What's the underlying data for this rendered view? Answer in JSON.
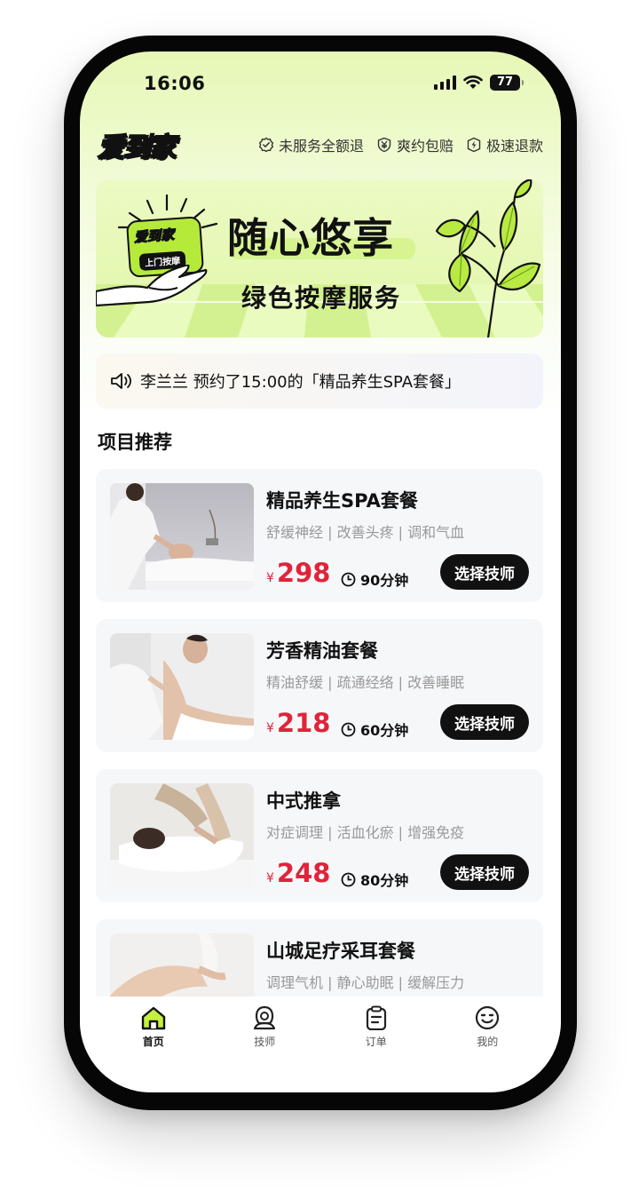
{
  "status": {
    "time": "16:06",
    "battery": "77"
  },
  "header": {
    "logo": "爱到家",
    "guarantees": [
      {
        "icon": "check-shield-icon",
        "label": "未服务全额退"
      },
      {
        "icon": "yuan-shield-icon",
        "label": "爽约包赔"
      },
      {
        "icon": "lightning-icon",
        "label": "极速退款"
      }
    ]
  },
  "banner": {
    "badge_top": "爱到家",
    "badge_bottom": "上门按摩",
    "title": "随心悠享",
    "subtitle": "绿色按摩服务"
  },
  "notice": {
    "icon": "speaker-icon",
    "text": "李兰兰 预约了15:00的「精品养生SPA套餐」"
  },
  "section": {
    "title": "项目推荐"
  },
  "services": [
    {
      "name": "精品养生SPA套餐",
      "tags": "舒缓神经 | 改善头疼 | 调和气血",
      "currency": "¥",
      "price": "298",
      "duration": "90分钟",
      "button": "选择技师"
    },
    {
      "name": "芳香精油套餐",
      "tags": "精油舒缓 | 疏通经络 | 改善睡眠",
      "currency": "¥",
      "price": "218",
      "duration": "60分钟",
      "button": "选择技师"
    },
    {
      "name": "中式推拿",
      "tags": "对症调理 | 活血化瘀 | 增强免疫",
      "currency": "¥",
      "price": "248",
      "duration": "80分钟",
      "button": "选择技师"
    },
    {
      "name": "山城足疗采耳套餐",
      "tags": "调理气机 | 静心助眠 | 缓解压力",
      "currency": "¥",
      "price": "",
      "duration": "",
      "button": ""
    }
  ],
  "tabbar": {
    "items": [
      {
        "label": "首页",
        "icon": "home-icon",
        "active": true
      },
      {
        "label": "技师",
        "icon": "technician-icon",
        "active": false
      },
      {
        "label": "订单",
        "icon": "clipboard-icon",
        "active": false
      },
      {
        "label": "我的",
        "icon": "smile-icon",
        "active": false
      }
    ]
  },
  "colors": {
    "accent_green": "#b6ea3a",
    "price_red": "#e0243a",
    "button_black": "#111111"
  }
}
